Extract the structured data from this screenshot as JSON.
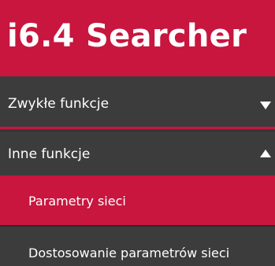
{
  "header": {
    "title": "i6.4 Searcher"
  },
  "menu": {
    "zwykle_funkcje": {
      "label": "Zwykłe funkcje",
      "icon": "chevron-down-icon"
    },
    "inne_funkcje": {
      "label": "Inne funkcje",
      "icon": "chevron-up-icon"
    },
    "subitems": [
      {
        "label": "Parametry sieci",
        "selected": true
      },
      {
        "label": "Dostosowanie parametrów sieci",
        "selected": false
      }
    ]
  },
  "colors": {
    "accent": "#c8163e",
    "background": "#3c3c3c",
    "text": "#ffffff"
  }
}
